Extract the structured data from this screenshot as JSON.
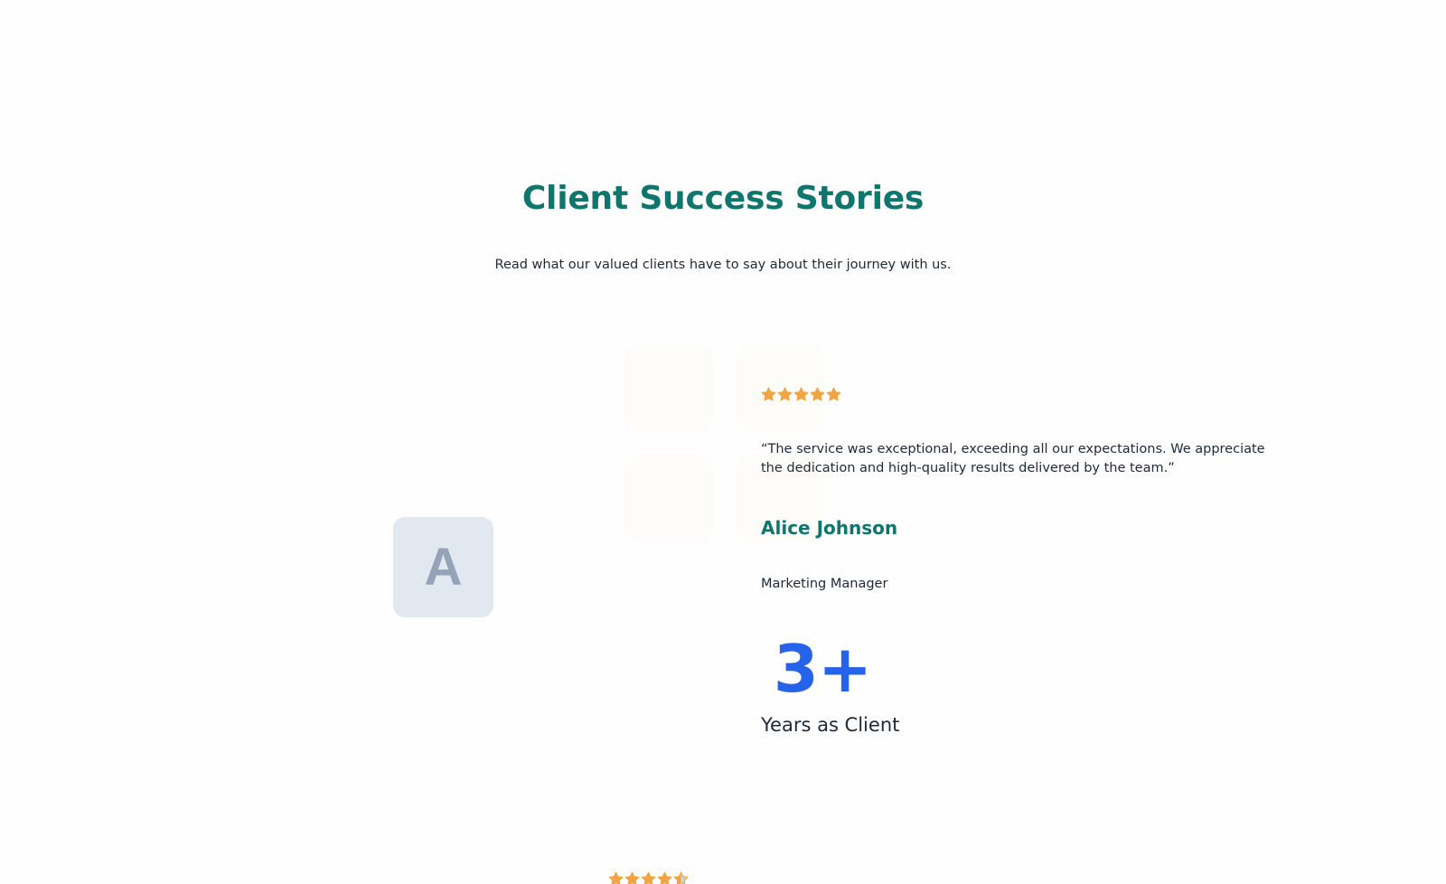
{
  "section": {
    "title": "Client Success Stories",
    "subtitle": "Read what our valued clients have to say about their journey with us."
  },
  "colors": {
    "title": "#0f766e",
    "accent_stat": "#2563eb",
    "star": "#f0a542",
    "star_empty": "#cbd5e1",
    "avatar_bg": "#e2e8f0",
    "avatar_letter": "#94a3b8"
  },
  "testimonials": [
    {
      "avatar_initial": "A",
      "rating": 5,
      "quote": "“The service was exceptional, exceeding all our expectations. We appreciate the dedication and high-quality results delivered by the team.”",
      "name": "Alice Johnson",
      "role": "Marketing Manager",
      "stat_value": "3+",
      "stat_label": "Years as Client"
    },
    {
      "rating": 4.5
    }
  ],
  "icons": {
    "rating_star": "star-icon"
  }
}
